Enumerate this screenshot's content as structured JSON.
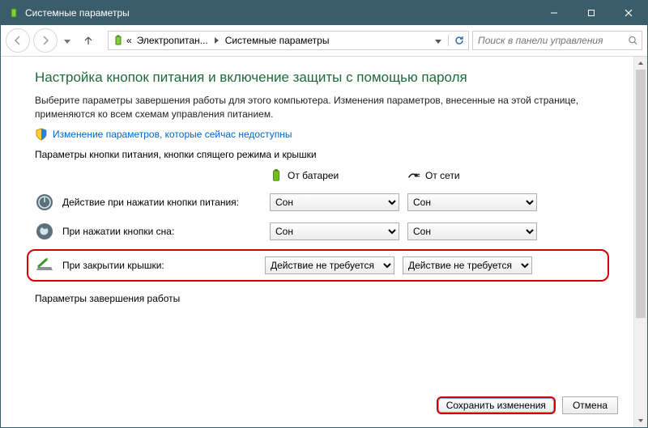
{
  "window": {
    "title": "Системные параметры"
  },
  "win_controls": {
    "minimize": "–",
    "maximize": "▢",
    "close": "✕"
  },
  "breadcrumb": {
    "item1": "Электропитан...",
    "item2": "Системные параметры"
  },
  "search": {
    "placeholder": "Поиск в панели управления"
  },
  "page": {
    "heading": "Настройка кнопок питания и включение защиты с помощью пароля",
    "desc": "Выберите параметры завершения работы для этого компьютера. Изменения параметров, внесенные на этой странице, применяются ко всем схемам управления питанием.",
    "unlock_link": "Изменение параметров, которые сейчас недоступны",
    "section1": "Параметры кнопки питания, кнопки спящего режима и крышки",
    "col_battery": "От батареи",
    "col_ac": "От сети",
    "row_power": "Действие при нажатии кнопки питания:",
    "row_sleep": "При нажатии кнопки сна:",
    "row_lid": "При закрытии крышки:",
    "opt_sleep": "Сон",
    "opt_noaction": "Действие не требуется",
    "section2": "Параметры завершения работы"
  },
  "buttons": {
    "save": "Сохранить изменения",
    "cancel": "Отмена"
  },
  "colors": {
    "title_green": "#206a3a",
    "link_blue": "#0066cc",
    "highlight_red": "#d40000",
    "titlebar": "#3b5c6b"
  },
  "icons": {
    "app": "power-options-icon",
    "back": "back-arrow-icon",
    "forward": "forward-arrow-icon",
    "breadcrumb_sep": "chevron-right-icon",
    "dropdown": "chevron-down-icon",
    "refresh": "refresh-icon",
    "shield": "shield-icon",
    "battery": "battery-icon",
    "plug": "plug-icon",
    "power_button": "power-button-icon",
    "sleep_button": "sleep-button-icon",
    "lid": "laptop-lid-icon",
    "scroll_up": "scroll-up-icon",
    "scroll_down": "scroll-down-icon"
  }
}
